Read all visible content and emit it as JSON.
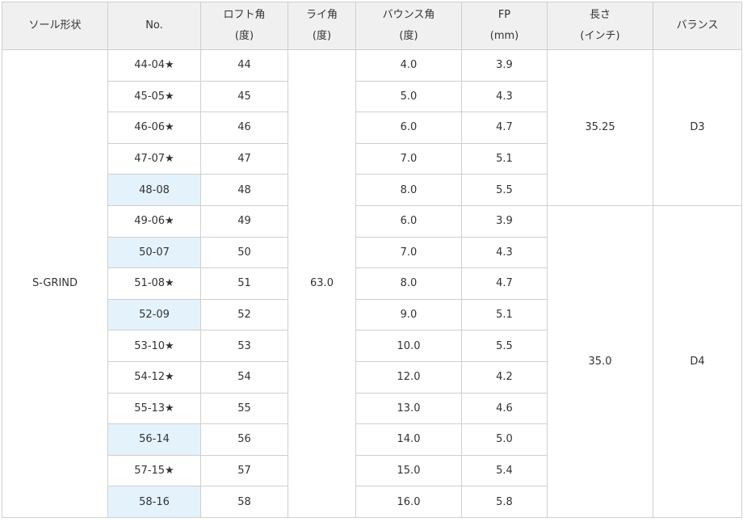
{
  "headers": [
    {
      "line1": "ソール形状",
      "line2": ""
    },
    {
      "line1": "No.",
      "line2": ""
    },
    {
      "line1": "ロフト角",
      "line2": "(度)"
    },
    {
      "line1": "ライ角",
      "line2": "(度)"
    },
    {
      "line1": "バウンス角",
      "line2": "(度)"
    },
    {
      "line1": "FP",
      "line2": "(mm)"
    },
    {
      "line1": "長さ",
      "line2": "(インチ)"
    },
    {
      "line1": "バランス",
      "line2": ""
    }
  ],
  "sole": "S-GRIND",
  "lie": "63.0",
  "groups": [
    {
      "length": "35.25",
      "balance": "D3"
    },
    {
      "length": "35.0",
      "balance": "D4"
    }
  ],
  "rows": [
    {
      "no": "44-04★",
      "loft": "44",
      "bounce": "4.0",
      "fp": "3.9",
      "highlight": false
    },
    {
      "no": "45-05★",
      "loft": "45",
      "bounce": "5.0",
      "fp": "4.3",
      "highlight": false
    },
    {
      "no": "46-06★",
      "loft": "46",
      "bounce": "6.0",
      "fp": "4.7",
      "highlight": false
    },
    {
      "no": "47-07★",
      "loft": "47",
      "bounce": "7.0",
      "fp": "5.1",
      "highlight": false
    },
    {
      "no": "48-08",
      "loft": "48",
      "bounce": "8.0",
      "fp": "5.5",
      "highlight": true
    },
    {
      "no": "49-06★",
      "loft": "49",
      "bounce": "6.0",
      "fp": "3.9",
      "highlight": false
    },
    {
      "no": "50-07",
      "loft": "50",
      "bounce": "7.0",
      "fp": "4.3",
      "highlight": true
    },
    {
      "no": "51-08★",
      "loft": "51",
      "bounce": "8.0",
      "fp": "4.7",
      "highlight": false
    },
    {
      "no": "52-09",
      "loft": "52",
      "bounce": "9.0",
      "fp": "5.1",
      "highlight": true
    },
    {
      "no": "53-10★",
      "loft": "53",
      "bounce": "10.0",
      "fp": "5.5",
      "highlight": false
    },
    {
      "no": "54-12★",
      "loft": "54",
      "bounce": "12.0",
      "fp": "4.2",
      "highlight": false
    },
    {
      "no": "55-13★",
      "loft": "55",
      "bounce": "13.0",
      "fp": "4.6",
      "highlight": false
    },
    {
      "no": "56-14",
      "loft": "56",
      "bounce": "14.0",
      "fp": "5.0",
      "highlight": true
    },
    {
      "no": "57-15★",
      "loft": "57",
      "bounce": "15.0",
      "fp": "5.4",
      "highlight": false
    },
    {
      "no": "58-16",
      "loft": "58",
      "bounce": "16.0",
      "fp": "5.8",
      "highlight": true
    }
  ],
  "colors": {
    "header_bg": "#f0f0f0",
    "highlight_bg": "#e4f2fb",
    "border": "#cfcfcf",
    "text": "#333333"
  }
}
